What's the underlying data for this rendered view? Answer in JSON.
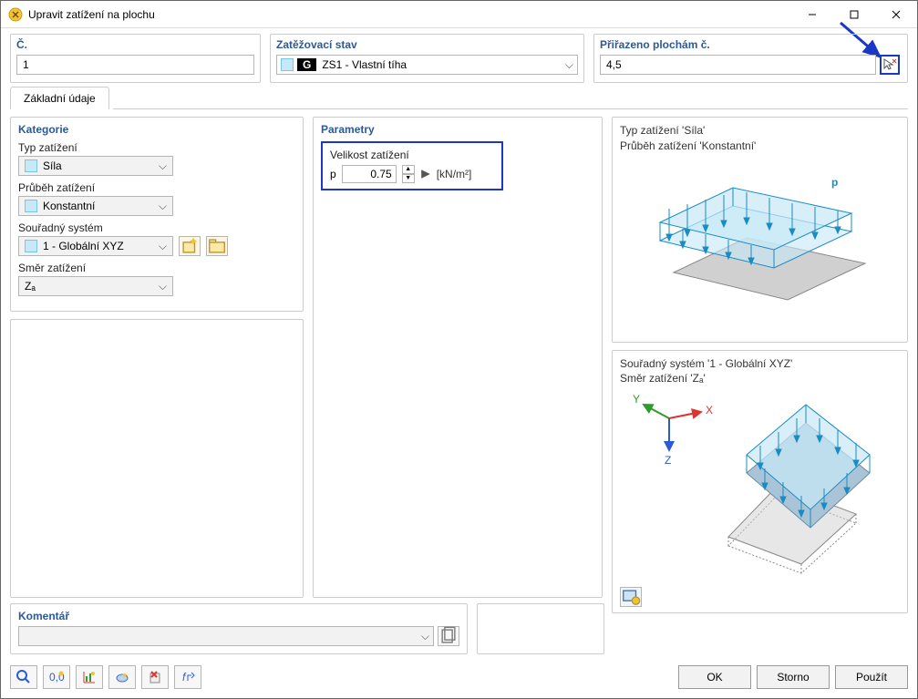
{
  "window": {
    "title": "Upravit zatížení na plochu"
  },
  "top": {
    "number_label": "Č.",
    "number_value": "1",
    "loadcase_label": "Zatěžovací stav",
    "loadcase_badge": "G",
    "loadcase_value": "ZS1 - Vlastní tíha",
    "assigned_label": "Přiřazeno plochám č.",
    "assigned_value": "4,5"
  },
  "tabs": {
    "basic": "Základní údaje"
  },
  "categories": {
    "title": "Kategorie",
    "type_label": "Typ zatížení",
    "type_value": "Síla",
    "distribution_label": "Průběh zatížení",
    "distribution_value": "Konstantní",
    "coordsys_label": "Souřadný systém",
    "coordsys_value": "1 - Globální XYZ",
    "direction_label": "Směr zatížení",
    "direction_value": "Zₐ"
  },
  "parameters": {
    "title": "Parametry",
    "magnitude_label": "Velikost zatížení",
    "symbol": "p",
    "value": "0.75",
    "unit": "[kN/m²]"
  },
  "preview1": {
    "line1": "Typ zatížení 'Síla'",
    "line2": "Průběh zatížení 'Konstantní'",
    "p_label": "p"
  },
  "preview2": {
    "line1": "Souřadný systém '1 - Globální XYZ'",
    "line2": "Směr zatížení 'Zₐ'",
    "x": "X",
    "y": "Y",
    "z": "Z"
  },
  "comment": {
    "title": "Komentář"
  },
  "buttons": {
    "ok": "OK",
    "cancel": "Storno",
    "apply": "Použít"
  }
}
